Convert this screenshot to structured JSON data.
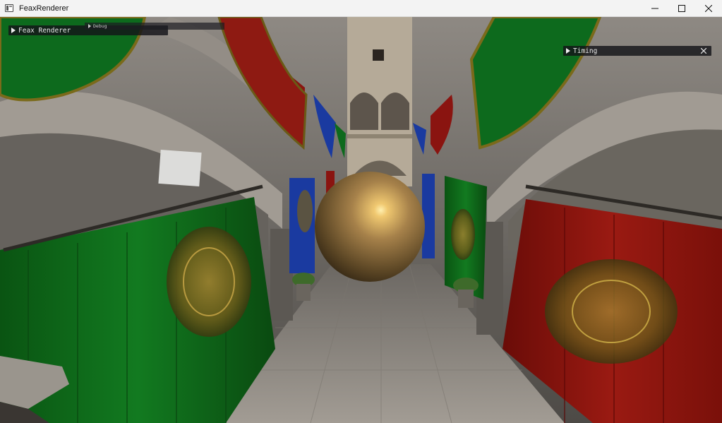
{
  "window": {
    "title": "FeaxRenderer",
    "controls": {
      "minimize": "minimize-icon",
      "maximize": "maximize-icon",
      "close": "close-icon"
    }
  },
  "overlays": {
    "main_panel": {
      "label": "Feax Renderer",
      "collapsed": true
    },
    "debug_panel": {
      "label": "Debug",
      "collapsed": true
    },
    "timing_panel": {
      "label": "Timing",
      "collapsed": true
    }
  },
  "colors": {
    "titlebar_bg": "#f3f3f3",
    "overlay_bg": "#141418",
    "banner_green": "#0f6a1a",
    "banner_red": "#8a1410",
    "banner_blue": "#1a3aa0",
    "sphere_gold": "#b08a50",
    "stone": "#8a8580"
  }
}
